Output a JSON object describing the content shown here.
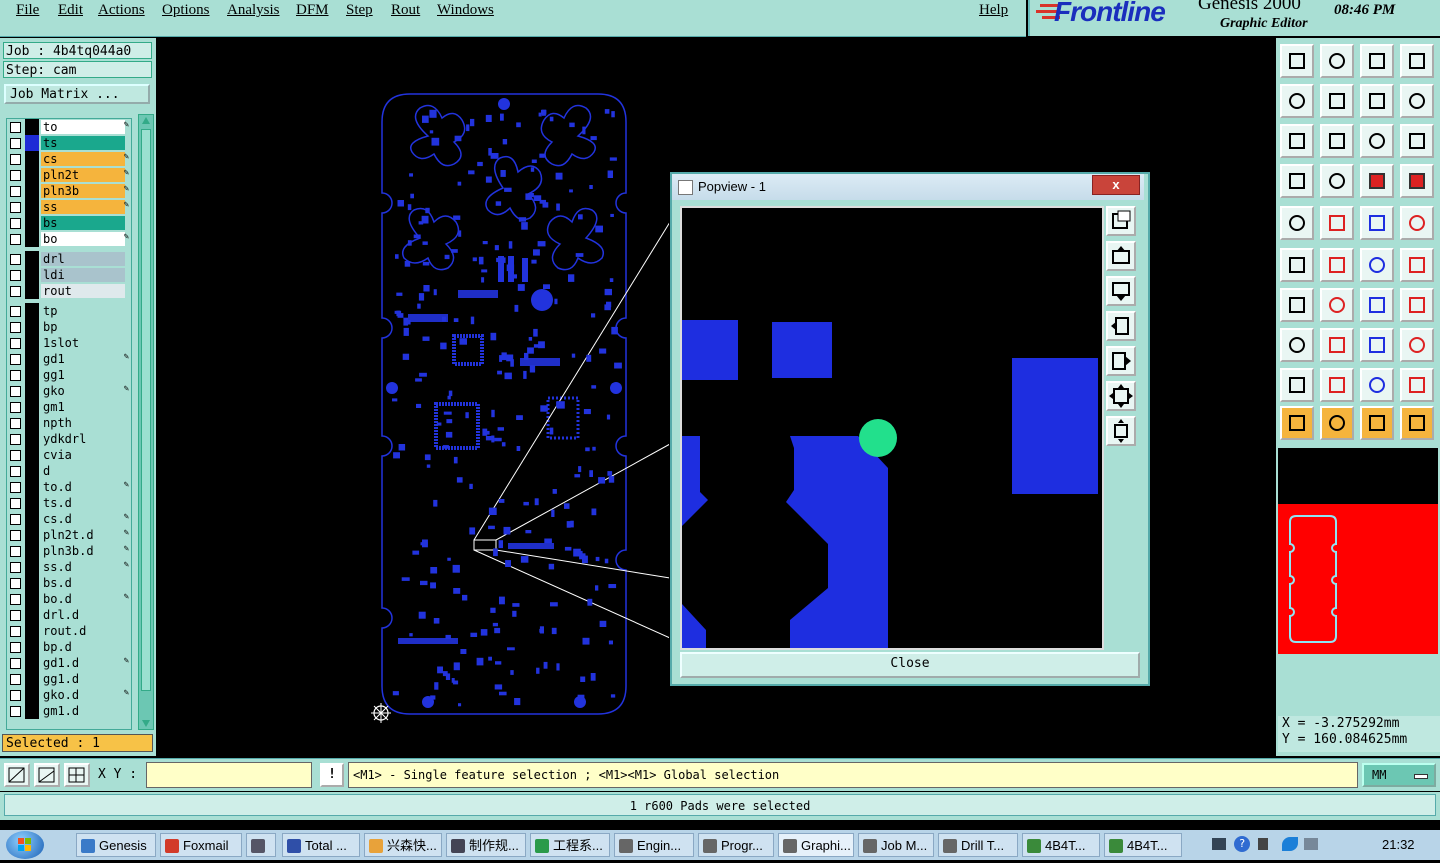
{
  "menu": [
    "File",
    "Edit",
    "Actions",
    "Options",
    "Analysis",
    "DFM",
    "Step",
    "Rout",
    "Windows"
  ],
  "help": "Help",
  "brand": {
    "logo": "Frontline",
    "product": "Genesis 2000",
    "subtitle": "Graphic Editor",
    "clock": "08:46 PM"
  },
  "job": {
    "job": "Job : 4b4tq044a0",
    "step": "Step: cam",
    "matrix": "Job Matrix ..."
  },
  "layer_groups": [
    [
      {
        "name": "to",
        "color": "#ffffff",
        "sw": "#000000",
        "pen": true
      },
      {
        "name": "ts",
        "color": "#1aa88d",
        "sw": "#1e2bd6",
        "pen": false
      },
      {
        "name": "cs",
        "color": "#f5b43d",
        "sw": "#000000",
        "pen": true
      },
      {
        "name": "pln2t",
        "color": "#f5b43d",
        "sw": "#000000",
        "pen": true
      },
      {
        "name": "pln3b",
        "color": "#f5b43d",
        "sw": "#000000",
        "pen": true
      },
      {
        "name": "ss",
        "color": "#f5b43d",
        "sw": "#000000",
        "pen": true
      },
      {
        "name": "bs",
        "color": "#1aa88d",
        "sw": "#000000",
        "pen": false
      },
      {
        "name": "bo",
        "color": "#ffffff",
        "sw": "#000000",
        "pen": true
      }
    ],
    [
      {
        "name": "drl",
        "color": "#a9c3cc",
        "sw": "#000000",
        "pen": false
      },
      {
        "name": "ldi",
        "color": "#a9c3cc",
        "sw": "#000000",
        "pen": false
      },
      {
        "name": "rout",
        "color": "#dfe9ec",
        "sw": "#000000",
        "pen": false
      }
    ],
    [
      {
        "name": "tp",
        "color": "#a9dfd4",
        "sw": "#000000",
        "pen": false
      },
      {
        "name": "bp",
        "color": "#a9dfd4",
        "sw": "#000000",
        "pen": false
      },
      {
        "name": "1slot",
        "color": "#a9dfd4",
        "sw": "#000000",
        "pen": false
      },
      {
        "name": "gd1",
        "color": "#a9dfd4",
        "sw": "#000000",
        "pen": true
      },
      {
        "name": "gg1",
        "color": "#a9dfd4",
        "sw": "#000000",
        "pen": false
      },
      {
        "name": "gko",
        "color": "#a9dfd4",
        "sw": "#000000",
        "pen": true
      },
      {
        "name": "gm1",
        "color": "#a9dfd4",
        "sw": "#000000",
        "pen": false
      },
      {
        "name": "npth",
        "color": "#a9dfd4",
        "sw": "#000000",
        "pen": false
      },
      {
        "name": "ydkdrl",
        "color": "#a9dfd4",
        "sw": "#000000",
        "pen": false
      },
      {
        "name": "cvia",
        "color": "#a9dfd4",
        "sw": "#000000",
        "pen": false
      },
      {
        "name": "d",
        "color": "#a9dfd4",
        "sw": "#000000",
        "pen": false
      },
      {
        "name": "to.d",
        "color": "#a9dfd4",
        "sw": "#000000",
        "pen": true
      },
      {
        "name": "ts.d",
        "color": "#a9dfd4",
        "sw": "#000000",
        "pen": false
      },
      {
        "name": "cs.d",
        "color": "#a9dfd4",
        "sw": "#000000",
        "pen": true
      },
      {
        "name": "pln2t.d",
        "color": "#a9dfd4",
        "sw": "#000000",
        "pen": true
      },
      {
        "name": "pln3b.d",
        "color": "#a9dfd4",
        "sw": "#000000",
        "pen": true
      },
      {
        "name": "ss.d",
        "color": "#a9dfd4",
        "sw": "#000000",
        "pen": true
      },
      {
        "name": "bs.d",
        "color": "#a9dfd4",
        "sw": "#000000",
        "pen": false
      },
      {
        "name": "bo.d",
        "color": "#a9dfd4",
        "sw": "#000000",
        "pen": true
      },
      {
        "name": "drl.d",
        "color": "#a9dfd4",
        "sw": "#000000",
        "pen": false
      },
      {
        "name": "rout.d",
        "color": "#a9dfd4",
        "sw": "#000000",
        "pen": false
      },
      {
        "name": "bp.d",
        "color": "#a9dfd4",
        "sw": "#000000",
        "pen": false
      },
      {
        "name": "gd1.d",
        "color": "#a9dfd4",
        "sw": "#000000",
        "pen": true
      },
      {
        "name": "gg1.d",
        "color": "#a9dfd4",
        "sw": "#000000",
        "pen": false
      },
      {
        "name": "gko.d",
        "color": "#a9dfd4",
        "sw": "#000000",
        "pen": true
      },
      {
        "name": "gm1.d",
        "color": "#a9dfd4",
        "sw": "#000000",
        "pen": false
      }
    ]
  ],
  "selected": "Selected : 1",
  "popup": {
    "title": "Popview - 1",
    "close_x": "x",
    "close_label": "Close"
  },
  "toolbar_icons": [
    "open-step-icon",
    "save-icon",
    "home-icon",
    "window-icon",
    "import-icon",
    "export-icon",
    "undo-icon",
    "redo-icon",
    "fit-icon",
    "center-icon",
    "zoom-1-2-icon",
    "help-icon",
    "eye-icon",
    "grid-icon",
    "layers-red-icon",
    "layers-gray-icon",
    "select-icon",
    "measure-icon",
    "ruler-icon",
    "circle-icon",
    "connect-icon",
    "delete-icon",
    "move-icon",
    "snap-icon",
    "line-icon",
    "arc-icon",
    "rotate-icon",
    "mirror-icon",
    "pad-icon",
    "split-icon",
    "resize-icon",
    "copy-icon",
    "triangle-icon",
    "peak-icon",
    "arch-icon",
    "bridge-icon",
    "pointer-icon",
    "pointer2-icon",
    "pointer3-icon",
    "route-icon"
  ],
  "coords": {
    "x": "X = -3.275292mm",
    "y": "Y = 160.084625mm"
  },
  "cmd": {
    "xy_label": "X Y :",
    "xy_value": "",
    "hint": "<M1> - Single feature selection ; <M1><M1> Global selection",
    "units": "MM"
  },
  "status": "1 r600 Pads were selected",
  "taskbar": {
    "items": [
      {
        "label": "Genesis",
        "color": "#3a7ac8"
      },
      {
        "label": "Foxmail",
        "color": "#d23b2a"
      },
      {
        "label": "",
        "color": "#556"
      },
      {
        "label": "Total ...",
        "color": "#2f4fa8"
      },
      {
        "label": "兴森快...",
        "color": "#e8a23a"
      },
      {
        "label": "制作规...",
        "color": "#445"
      },
      {
        "label": "工程系...",
        "color": "#2a9a4a"
      },
      {
        "label": "Engin...",
        "color": "#666"
      },
      {
        "label": "Progr...",
        "color": "#666"
      },
      {
        "label": "Graphi...",
        "color": "#666"
      },
      {
        "label": "Job M...",
        "color": "#666"
      },
      {
        "label": "Drill T...",
        "color": "#666"
      },
      {
        "label": "4B4T...",
        "color": "#3a8a3a"
      },
      {
        "label": "4B4T...",
        "color": "#3a8a3a"
      }
    ],
    "time": "21:32"
  }
}
